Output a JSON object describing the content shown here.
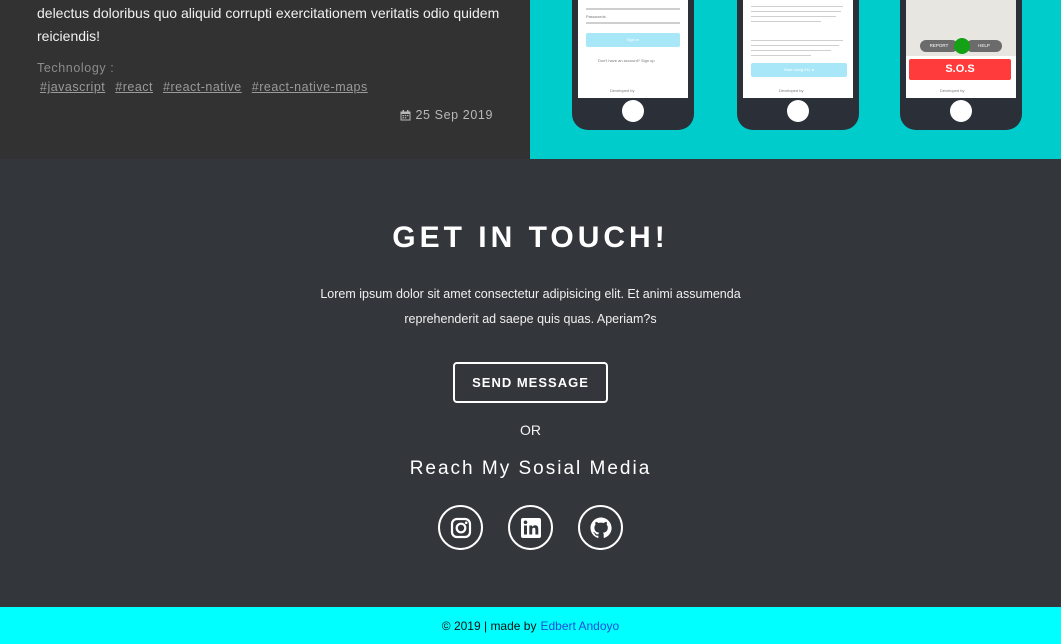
{
  "project": {
    "description": "delectus doloribus quo aliquid corrupti exercitationem veritatis odio quidem reiciendis!",
    "technology_label": "Technology :",
    "tags": [
      "#javascript",
      "#react",
      "#react-native",
      "#react-native-maps"
    ],
    "date": "25 Sep 2019",
    "screens": {
      "login": {
        "password_label": "Passwords",
        "sign_in": "Sign in",
        "signup_prompt": "Don't have an account? Sign up",
        "dev_by": "Developed by"
      },
      "info": {
        "start_button": "Start using 911 ●",
        "dev_by": "Developed by"
      },
      "map": {
        "report": "REPORT",
        "help": "HELP",
        "sos": "S.O.S",
        "dev_by": "Developed by"
      }
    }
  },
  "contact": {
    "title": "GET IN TOUCH!",
    "description": "Lorem ipsum dolor sit amet consectetur adipisicing elit. Et animi assumenda reprehenderit ad saepe quis quas. Aperiam?s",
    "send_button": "SEND MESSAGE",
    "or": "OR",
    "reach_title": "Reach My Sosial Media",
    "socials": [
      "instagram-icon",
      "linkedin-icon",
      "github-icon"
    ]
  },
  "footer": {
    "copyright": "© 2019 | made by",
    "author": "Edbert Andoyo"
  },
  "colors": {
    "accent": "#00ffff",
    "project_bg": "#00cccc",
    "contact_bg": "#33363b",
    "sos_red": "#ff3b3b",
    "link_blue": "#1a4fd6"
  }
}
